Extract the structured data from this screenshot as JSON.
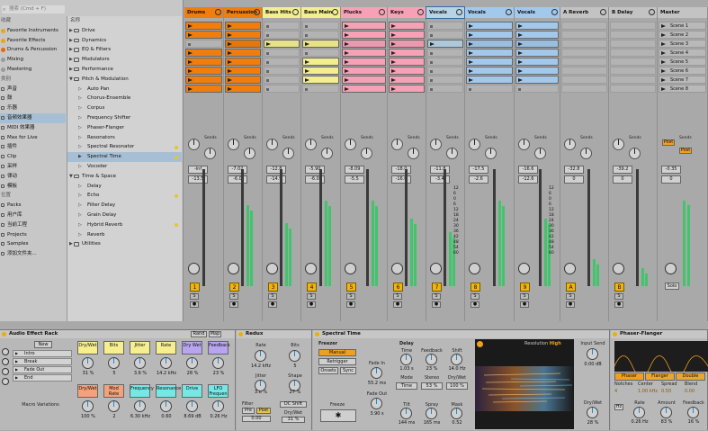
{
  "browser": {
    "search_placeholder": "搜索 (Cmd + F)",
    "places": [
      {
        "label": "收藏",
        "type": "section"
      },
      {
        "label": "Favorite Instruments",
        "color": "#e8a617"
      },
      {
        "label": "Favorite Effects",
        "color": "#e8a617"
      },
      {
        "label": "Drums & Percussion",
        "color": "#e06b13"
      },
      {
        "label": "Mixing",
        "color": "#9a9a9a"
      },
      {
        "label": "Mastering",
        "color": "#9a9a9a"
      },
      {
        "label": "类别",
        "type": "section"
      },
      {
        "label": "声音"
      },
      {
        "label": "鼓"
      },
      {
        "label": "乐器"
      },
      {
        "label": "音频效果器",
        "selected": true
      },
      {
        "label": "MIDI 效果器"
      },
      {
        "label": "Max for Live"
      },
      {
        "label": "插件"
      },
      {
        "label": "Clip"
      },
      {
        "label": "采样"
      },
      {
        "label": "律动"
      },
      {
        "label": "模板"
      },
      {
        "label": "位置",
        "type": "section"
      },
      {
        "label": "Packs"
      },
      {
        "label": "用户库"
      },
      {
        "label": "当前工程"
      },
      {
        "label": "Projects"
      },
      {
        "label": "Samples"
      },
      {
        "label": "添加文件夹..."
      }
    ],
    "column_header": "名称",
    "items": [
      {
        "label": "Drive",
        "level": 0
      },
      {
        "label": "Dynamics",
        "level": 0
      },
      {
        "label": "EQ & Filters",
        "level": 0
      },
      {
        "label": "Modulators",
        "level": 0
      },
      {
        "label": "Performance",
        "level": 0
      },
      {
        "label": "Pitch & Modulation",
        "level": 0,
        "open": true
      },
      {
        "label": "Auto Pan",
        "level": 1
      },
      {
        "label": "Chorus-Ensemble",
        "level": 1
      },
      {
        "label": "Corpus",
        "level": 1
      },
      {
        "label": "Frequency Shifter",
        "level": 1
      },
      {
        "label": "Phaser-Flanger",
        "level": 1
      },
      {
        "label": "Resonators",
        "level": 1
      },
      {
        "label": "Spectral Resonator",
        "level": 1,
        "dot": true
      },
      {
        "label": "Spectral Time",
        "level": 1,
        "dot": true,
        "selected": true
      },
      {
        "label": "Vocoder",
        "level": 1
      },
      {
        "label": "Time & Space",
        "level": 0,
        "open": true
      },
      {
        "label": "Delay",
        "level": 1
      },
      {
        "label": "Echo",
        "level": 1,
        "dot": true
      },
      {
        "label": "Filter Delay",
        "level": 1
      },
      {
        "label": "Grain Delay",
        "level": 1
      },
      {
        "label": "Hybrid Reverb",
        "level": 1,
        "dot": true
      },
      {
        "label": "Reverb",
        "level": 1
      },
      {
        "label": "Utilities",
        "level": 0
      }
    ]
  },
  "tracks": [
    {
      "name": "Drums",
      "color": "#f07d0c",
      "clip_rows": [
        1,
        1,
        0,
        1,
        1,
        1,
        1,
        1
      ],
      "vol": "-Inf",
      "pan": "-13.5",
      "num": "1"
    },
    {
      "name": "Percussion",
      "color": "#f07d0c",
      "clip_rows": [
        1,
        1,
        1,
        1,
        1,
        1,
        1,
        1
      ],
      "vol": "-7.02",
      "pan": "-6.0",
      "num": "2"
    },
    {
      "name": "Bass Hits",
      "color": "#f3ee8e",
      "clip_rows": [
        0,
        0,
        1,
        0,
        0,
        0,
        0,
        0
      ],
      "vol": "-12.8",
      "pan": "-14.9",
      "num": "3"
    },
    {
      "name": "Bass Main",
      "color": "#f3ee8e",
      "clip_rows": [
        0,
        0,
        1,
        0,
        1,
        1,
        1,
        0
      ],
      "vol": "-5.90",
      "pan": "-6.0",
      "num": "4"
    },
    {
      "name": "Plucks",
      "color": "#f7a1b7",
      "clip_rows": [
        1,
        1,
        1,
        1,
        1,
        1,
        1,
        1
      ],
      "vol": "-8.09",
      "pan": "-5.5",
      "num": "5"
    },
    {
      "name": "Keys",
      "color": "#f7a1b7",
      "clip_rows": [
        1,
        1,
        1,
        1,
        1,
        1,
        1,
        1
      ],
      "vol": "-18.0",
      "pan": "-16.0",
      "num": "6"
    },
    {
      "name": "Vocals",
      "color": "#b7d3e6",
      "clip_rows": [
        0,
        0,
        1,
        0,
        0,
        0,
        0,
        0
      ],
      "vol": "-11.8",
      "pan": "-3.4",
      "num": "7"
    },
    {
      "name": "Vocals",
      "color": "#a2c8ec",
      "clip_rows": [
        1,
        1,
        1,
        1,
        1,
        1,
        1,
        0
      ],
      "vol": "-17.5",
      "pan": "-2.6",
      "num": "8"
    },
    {
      "name": "Vocals",
      "color": "#a2c8ec",
      "clip_rows": [
        1,
        1,
        1,
        1,
        1,
        1,
        1,
        0
      ],
      "vol": "-16.6",
      "pan": "-12.6",
      "num": "9"
    },
    {
      "name": "A Reverb",
      "color": "#c3c3c3",
      "clip_rows": [],
      "vol": "-32.8",
      "pan": "0",
      "num": "A"
    },
    {
      "name": "B Delay",
      "color": "#c3c3c3",
      "clip_rows": [],
      "vol": "-39.2",
      "pan": "0",
      "num": "B"
    }
  ],
  "track_labels": {
    "sends": "Sends",
    "solo": "S",
    "a": "A",
    "b": "B"
  },
  "io_values": [
    "1",
    "32",
    "1",
    "32",
    "",
    "1",
    "40",
    "1",
    "32",
    "1",
    "32",
    "1",
    "32"
  ],
  "master": {
    "name": "Master",
    "scenes": [
      "Scene 1",
      "Scene 2",
      "Scene 3",
      "Scene 4",
      "Scene 5",
      "Scene 6",
      "Scene 7",
      "Scene 8"
    ],
    "vol": "-0.35",
    "pan": "0",
    "post": "Post",
    "solo": "Solo",
    "sends": "Sends"
  },
  "scale": [
    "12",
    "6",
    "0",
    "6",
    "12",
    "18",
    "24",
    "30",
    "36",
    "42",
    "48",
    "54",
    "60"
  ],
  "rack": {
    "title": "Audio Effect Rack",
    "new_label": "New",
    "chains": [
      "Intro",
      "Break",
      "Fade Out",
      "End"
    ],
    "macro_variations": "Macro Variations",
    "rand": "Rand",
    "map": "Map",
    "macros_top": [
      {
        "label": "Dry/Wet",
        "color": "#f7ee8f",
        "value": "31 %"
      },
      {
        "label": "Bits",
        "color": "#f7ee8f",
        "value": "5"
      },
      {
        "label": "Jitter",
        "color": "#f7ee8f",
        "value": "3.6 %"
      },
      {
        "label": "Rate",
        "color": "#f7ee8f",
        "value": "14.2 kHz"
      },
      {
        "label": "Dry Wet",
        "color": "#b7a6ef",
        "value": "28 %"
      },
      {
        "label": "Feedback",
        "color": "#b7a6ef",
        "value": "23 %"
      }
    ],
    "macros_bottom": [
      {
        "label": "Dry/Wet",
        "color": "#f3a27a",
        "value": "100 %"
      },
      {
        "label": "Mod Rate",
        "color": "#f3a27a",
        "value": "2"
      },
      {
        "label": "Frequency",
        "color": "#76e7e5",
        "value": "6.30 kHz"
      },
      {
        "label": "Resonance",
        "color": "#76e7e5",
        "value": "0.60"
      },
      {
        "label": "Drive",
        "color": "#76e7e5",
        "value": "8.69 dB"
      },
      {
        "label": "LFO Frequen",
        "color": "#76e7e5",
        "value": "0.26 Hz"
      }
    ]
  },
  "redux": {
    "title": "Redux",
    "rate_label": "Rate",
    "rate": "14.2 kHz",
    "bits_label": "Bits",
    "bits": "5",
    "jitter_label": "Jitter",
    "jitter": "3.6 %",
    "shape_label": "Shape",
    "shape": "27 %",
    "filter_label": "Filter",
    "pre": "Pre",
    "post": "Post",
    "filter_val": "0.00",
    "dc_shift": "DC Shift",
    "drywet_label": "Dry/Wet",
    "drywet": "31 %"
  },
  "spectral": {
    "title": "Spectral Time",
    "freezer": "Freezer",
    "manual": "Manual",
    "retrigger": "Retrigger",
    "onsets": "Onsets",
    "sync": "Sync",
    "freeze": "Freeze",
    "fadein_label": "Fade In",
    "fadein": "55.2 ms",
    "fadeout_label": "Fade Out",
    "fadeout": "3.90 s",
    "delay": "Delay",
    "time_label": "Time",
    "time": "1.03 s",
    "feedback_label": "Feedback",
    "feedback": "23 %",
    "shift_label": "Shift",
    "shift": "14.0 Hz",
    "mode_label": "Mode",
    "mode": "Time",
    "stereo_label": "Stereo",
    "stereo": "53 %",
    "drywet_label": "Dry/Wet",
    "drywet": "100 %",
    "tilt_label": "Tilt",
    "tilt": "144 ms",
    "spray_label": "Spray",
    "spray": "165 ms",
    "mask_label": "Mask",
    "mask": "0.52",
    "resolution_label": "Resolution",
    "resolution": "High",
    "input_send_label": "Input Send",
    "input_send": "0.00 dB",
    "drywet2": "28 %"
  },
  "phaser": {
    "title": "Phaser-Flanger",
    "modes": [
      "Phaser",
      "Flanger",
      "Double"
    ],
    "notches_label": "Notches",
    "notches": "4",
    "center_label": "Center",
    "center": "1.00 kHz",
    "spread_label": "Spread",
    "spread": "0.50",
    "blend_label": "Blend",
    "blend": "0.00",
    "rate_label": "Rate",
    "rate": "0.26 Hz",
    "amount_label": "Amount",
    "amount": "83 %",
    "feedback_label": "Feedback",
    "feedback": "16 %",
    "hz": "Hz"
  },
  "colors": {
    "level_green": "#41c46b",
    "accent_orange": "#f07d0c",
    "selection_blue": "#a7bfd4",
    "track_number_yellow": "#f0b40a"
  }
}
